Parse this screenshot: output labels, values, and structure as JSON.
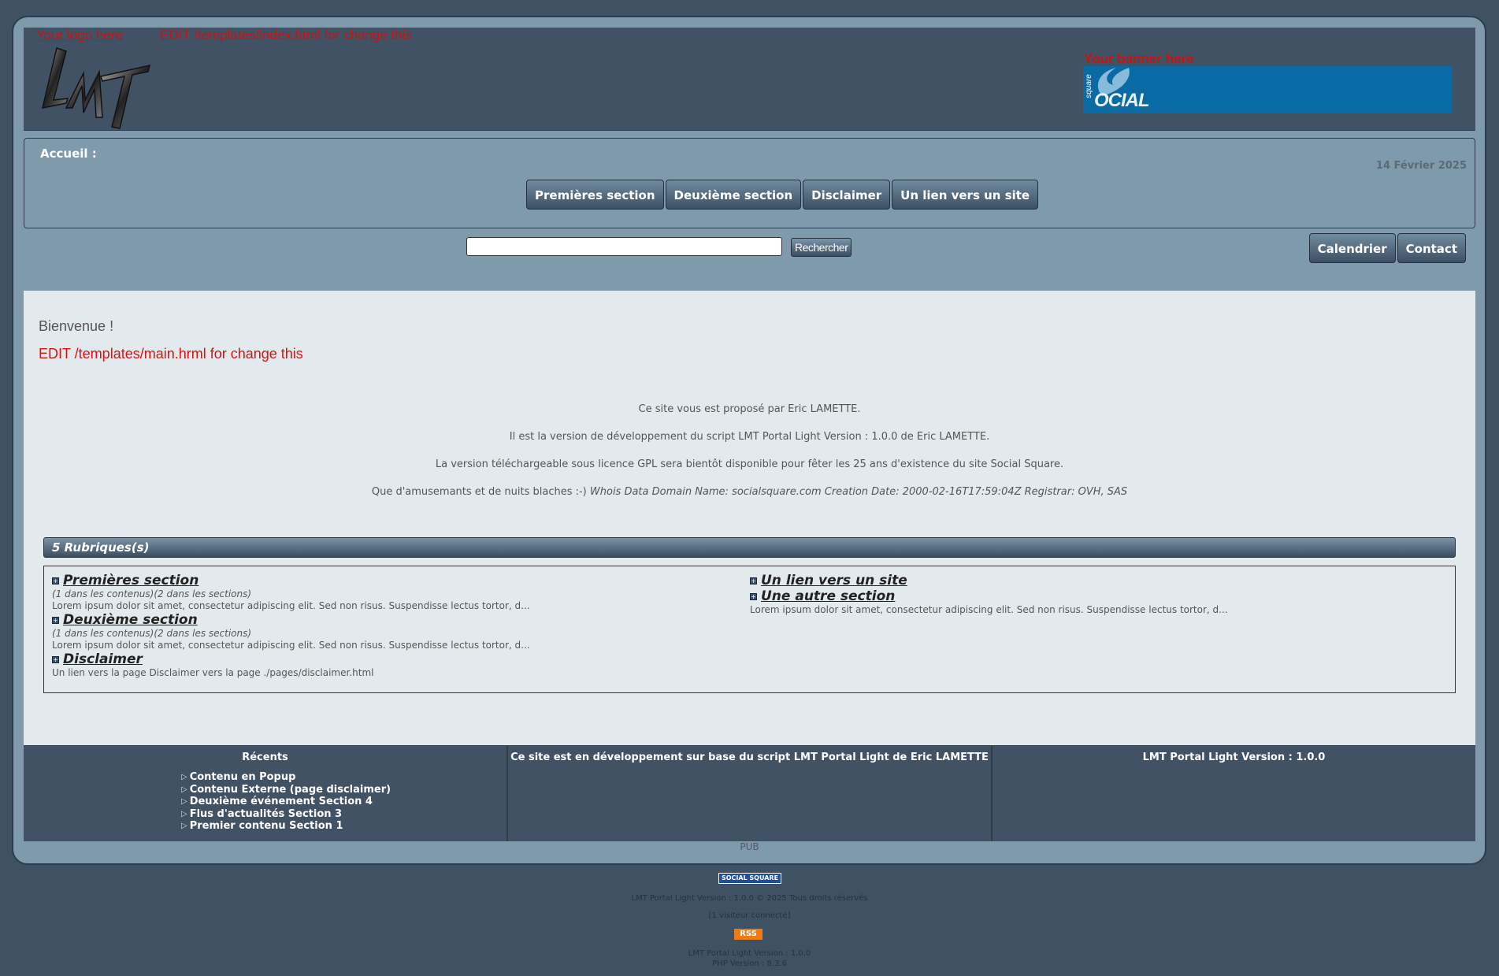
{
  "header": {
    "logo_text": "Your logo here",
    "logo_edit_note": "EDIT /templates/index.html for change this",
    "logo_mark": "LMT",
    "banner_label": "Your banner here",
    "banner_text": "OCIAL",
    "banner_small": "square"
  },
  "nav": {
    "accueil": "Accueil :",
    "date": "14 Février 2025",
    "items": [
      "Premières section",
      "Deuxième section",
      "Disclaimer",
      "Un lien vers un site"
    ]
  },
  "search": {
    "button": "Rechercher",
    "placeholder": ""
  },
  "side_buttons": [
    "Calendrier",
    "Contact"
  ],
  "main": {
    "welcome": "Bienvenue !",
    "edit_note": "EDIT /templates/main.hrml for change this",
    "intro_lines": [
      "Ce site vous est proposé par Eric LAMETTE.",
      "Il est la version de développement du script LMT Portal Light Version : 1.0.0 de Eric LAMETTE.",
      "La version téléchargeable sous licence GPL sera bientôt disponible pour fêter les 25 ans d'existence du site Social Square."
    ],
    "intro_last_prefix": "Que d'amusemants et de nuits blaches :-)",
    "intro_last_italic": "Whois Data Domain Name: socialsquare.com Creation Date: 2000-02-16T17:59:04Z Registrar: OVH, SAS"
  },
  "rubriques": {
    "header": "5 Rubriques(s)",
    "left": [
      {
        "title": "Premières section",
        "meta": "(1 dans les contenus)(2 dans les sections)",
        "desc": "Lorem ipsum dolor sit amet, consectetur adipiscing elit. Sed non risus. Suspendisse lectus tortor, d..."
      },
      {
        "title": "Deuxième section",
        "meta": "(1 dans les contenus)(2 dans les sections)",
        "desc": "Lorem ipsum dolor sit amet, consectetur adipiscing elit. Sed non risus. Suspendisse lectus tortor, d..."
      },
      {
        "title": "Disclaimer",
        "meta": "",
        "desc": "Un lien vers la page Disclaimer vers la page ./pages/disclaimer.html"
      }
    ],
    "right": [
      {
        "title": "Un lien vers un site",
        "meta": "",
        "desc": ""
      },
      {
        "title": "Une autre section",
        "meta": "",
        "desc": "Lorem ipsum dolor sit amet, consectetur adipiscing elit. Sed non risus. Suspendisse lectus tortor, d..."
      }
    ]
  },
  "footer": {
    "col1_title": "Récents",
    "recent": [
      "Contenu en Popup",
      "Contenu Externe (page disclaimer)",
      "Deuxième événement Section 4",
      "Flus d'actualités Section 3",
      "Premier contenu Section 1"
    ],
    "col2_title": "Ce site est en développement sur base du script LMT Portal Light de Eric LAMETTE",
    "col3_title": "LMT Portal Light Version : 1.0.0"
  },
  "bottom": {
    "pub": "PUB",
    "badge": "SOCIAL SQUARE",
    "copyright": "LMT Portal Light Version : 1.0.0 © 2025 Tous droits réservés",
    "visitors": "[1 visiteur connecté]",
    "rss": "RSS",
    "version1": "LMT Portal Light Version : 1.0.0",
    "version2": "PHP Version : 8.3.6"
  }
}
